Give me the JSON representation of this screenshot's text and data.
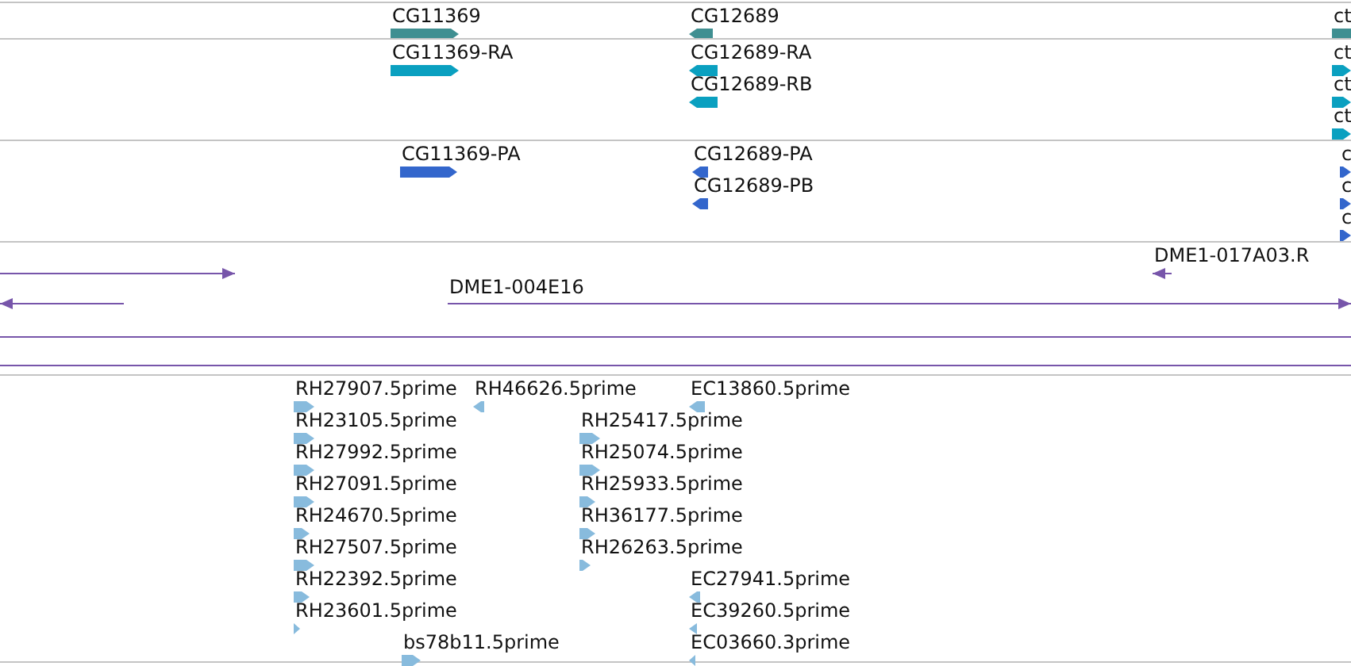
{
  "tracks": [
    {
      "color": "#3f8f91",
      "features": [
        {
          "label": "CG11369",
          "reverse": false
        },
        {
          "label": "CG12689",
          "reverse": true
        },
        {
          "label": "ct",
          "reverse": false
        }
      ]
    },
    {
      "color": "#0aa0c0",
      "features": [
        {
          "label": "CG11369-RA",
          "reverse": false
        },
        {
          "label": "CG12689-RA",
          "reverse": true
        },
        {
          "label": "CG12689-RB",
          "reverse": true
        },
        {
          "label": "ct",
          "reverse": false
        },
        {
          "label": "ct",
          "reverse": false
        },
        {
          "label": "ct",
          "reverse": false
        }
      ]
    },
    {
      "color": "#3366cc",
      "features": [
        {
          "label": "CG11369-PA",
          "reverse": false
        },
        {
          "label": "CG12689-PA",
          "reverse": true
        },
        {
          "label": "CG12689-PB",
          "reverse": true
        },
        {
          "label": "c",
          "reverse": false
        },
        {
          "label": "c",
          "reverse": false
        },
        {
          "label": "c",
          "reverse": false
        }
      ]
    },
    {
      "color": "#7755aa",
      "features": [
        {
          "reverse": false
        },
        {
          "reverse": true
        },
        {
          "label": "DME1-017A03.R",
          "reverse": true
        },
        {
          "label": "DME1-004E16",
          "reverse": false
        },
        {
          "reverse": false
        },
        {
          "reverse": false
        }
      ]
    },
    {
      "color": "#88bbdd",
      "features": [
        {
          "label": "RH27907.5prime",
          "reverse": false
        },
        {
          "label": "RH46626.5prime",
          "reverse": true
        },
        {
          "label": "EC13860.5prime",
          "reverse": true
        },
        {
          "label": "RH23105.5prime",
          "reverse": false
        },
        {
          "label": "RH25417.5prime",
          "reverse": false
        },
        {
          "label": "RH27992.5prime",
          "reverse": false
        },
        {
          "label": "RH25074.5prime",
          "reverse": false
        },
        {
          "label": "RH27091.5prime",
          "reverse": false
        },
        {
          "label": "RH25933.5prime",
          "reverse": false
        },
        {
          "label": "RH24670.5prime",
          "reverse": false
        },
        {
          "label": "RH36177.5prime",
          "reverse": false
        },
        {
          "label": "RH27507.5prime",
          "reverse": false
        },
        {
          "label": "RH26263.5prime",
          "reverse": false
        },
        {
          "label": "RH22392.5prime",
          "reverse": false
        },
        {
          "label": "EC27941.5prime",
          "reverse": true
        },
        {
          "label": "RH23601.5prime",
          "reverse": false
        },
        {
          "label": "EC39260.5prime",
          "reverse": true
        },
        {
          "label": "bs78b11.5prime",
          "reverse": false
        },
        {
          "label": "EC03660.3prime",
          "reverse": true
        }
      ]
    }
  ]
}
